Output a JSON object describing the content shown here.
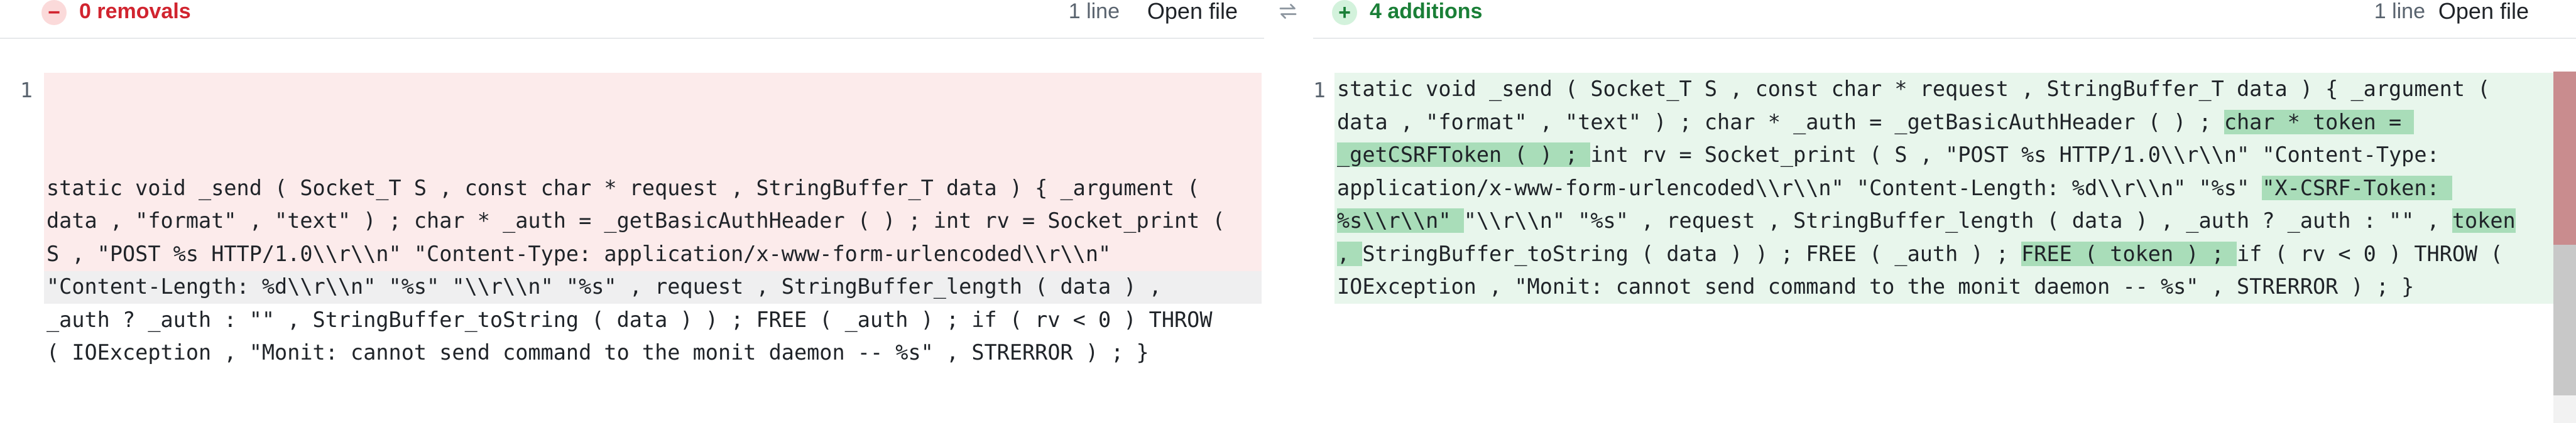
{
  "left": {
    "icon": "minus-circle-icon",
    "title": "0 removals",
    "line_count": "1 line",
    "open_file": "Open file",
    "line_number": "1",
    "lines": [
      "static void _send ( Socket_T S , const char * request , StringBuffer_T data ) { _argument (",
      "data , \"format\" , \"text\" ) ; char * _auth = _getBasicAuthHeader ( ) ; int rv = Socket_print (",
      "S , \"POST %s HTTP/1.0\\\\r\\\\n\" \"Content-Type: application/x-www-form-urlencoded\\\\r\\\\n\"",
      "\"Content-Length: %d\\\\r\\\\n\" \"%s\" \"\\\\r\\\\n\" \"%s\" , request , StringBuffer_length ( data ) ,",
      "_auth ? _auth : \"\" , StringBuffer_toString ( data ) ) ; FREE ( _auth ) ; if ( rv < 0 ) THROW",
      "( IOException , \"Monit: cannot send command to the monit daemon -- %s\" , STRERROR ) ; }"
    ]
  },
  "swap_icon": "swap-arrows-icon",
  "right": {
    "icon": "plus-circle-icon",
    "title": "4 additions",
    "line_count": "1 line",
    "open_file": "Open file",
    "line_number": "1",
    "lines": [
      [
        {
          "t": "static void _send ( Socket_T S , const char * request , StringBuffer_T data ) { _argument (",
          "h": false
        }
      ],
      [
        {
          "t": "data , \"format\" , \"text\" ) ; char * _auth = _getBasicAuthHeader ( ) ; ",
          "h": false
        },
        {
          "t": "char * token = ",
          "h": true
        }
      ],
      [
        {
          "t": "_getCSRFToken ( ) ; ",
          "h": true
        },
        {
          "t": "int rv = Socket_print ( S , \"POST %s HTTP/1.0\\\\r\\\\n\" \"Content-Type:",
          "h": false
        }
      ],
      [
        {
          "t": "application/x-www-form-urlencoded\\\\r\\\\n\" \"Content-Length: %d\\\\r\\\\n\" \"%s\" ",
          "h": false
        },
        {
          "t": "\"X-CSRF-Token: ",
          "h": true
        }
      ],
      [
        {
          "t": "%s\\\\r\\\\n\" ",
          "h": true
        },
        {
          "t": "\"\\\\r\\\\n\" \"%s\" , request , StringBuffer_length ( data ) , _auth ? _auth : \"\" , ",
          "h": false
        },
        {
          "t": "token",
          "h": true
        }
      ],
      [
        {
          "t": ", ",
          "h": true
        },
        {
          "t": "StringBuffer_toString ( data ) ) ; FREE ( _auth ) ; ",
          "h": false
        },
        {
          "t": "FREE ( token ) ; ",
          "h": true
        },
        {
          "t": "if ( rv < 0 ) THROW (",
          "h": false
        }
      ],
      [
        {
          "t": "IOException , \"Monit: cannot send command to the monit daemon -- %s\" , STRERROR ) ; }",
          "h": false
        }
      ]
    ]
  }
}
